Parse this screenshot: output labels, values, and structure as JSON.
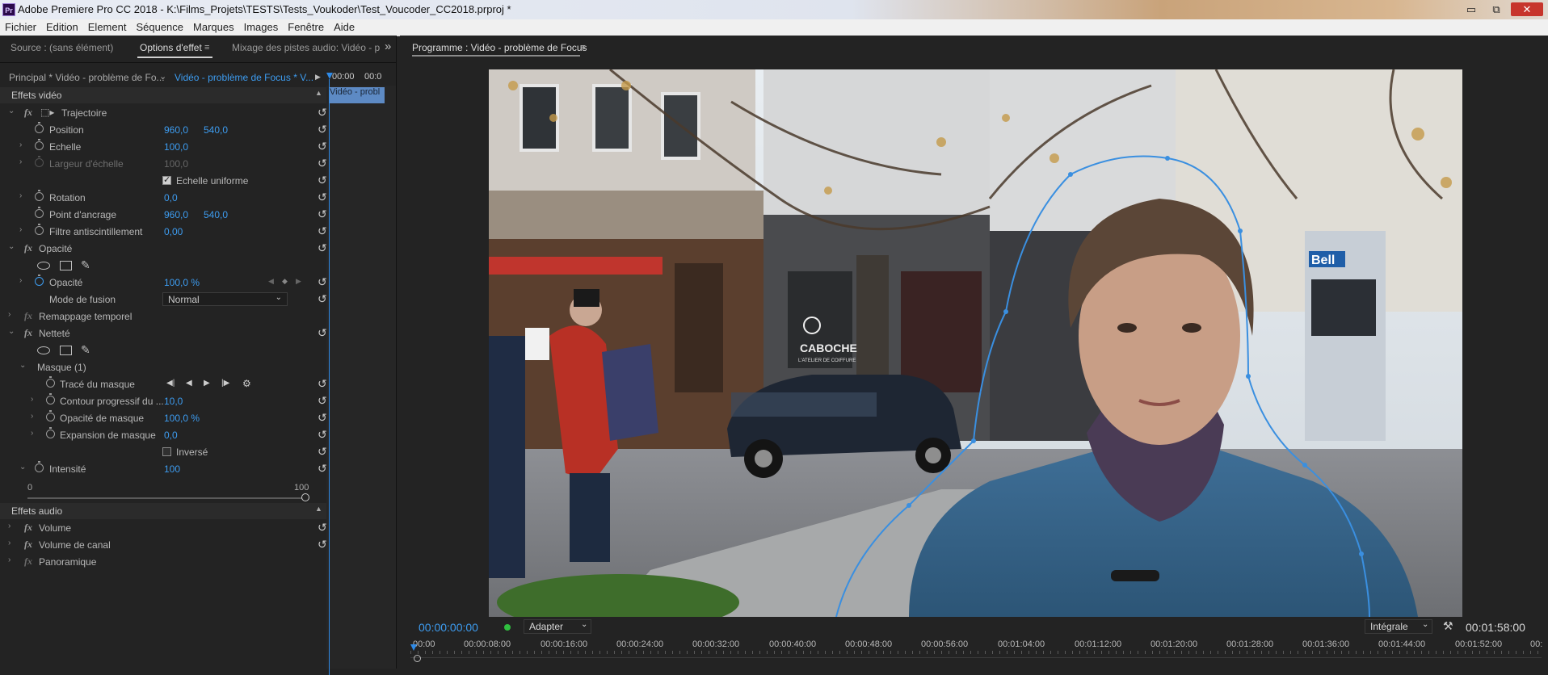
{
  "window": {
    "app_icon": "Pr",
    "title": "Adobe Premiere Pro CC 2018 - K:\\Films_Projets\\TESTS\\Tests_Voukoder\\Test_Voucoder_CC2018.prproj *",
    "minimize": "▭",
    "maximize": "⧉",
    "close": "✕"
  },
  "menu": [
    "Fichier",
    "Edition",
    "Element",
    "Séquence",
    "Marques",
    "Images",
    "Fenêtre",
    "Aide"
  ],
  "left_panel": {
    "tabs": {
      "source": "Source : (sans élément)",
      "effect_options": "Options d'effet",
      "audio_mix": "Mixage des pistes audio: Vidéo - p",
      "overflow": "»",
      "menu_icon": "≡"
    },
    "clip_selector": {
      "master": "Principal * Vidéo - problème de Fo...",
      "clip": "Vidéo - problème de Focus * V...",
      "play": "▶",
      "tc_start": "00:00",
      "tc_end": "00:0"
    },
    "mini_clip": "Vidéo - probl",
    "video_effects_header": "Effets vidéo",
    "audio_effects_header": "Effets audio",
    "effects": {
      "trajectoire": "Trajectoire",
      "position": {
        "label": "Position",
        "x": "960,0",
        "y": "540,0"
      },
      "echelle": {
        "label": "Echelle",
        "value": "100,0"
      },
      "largeur": {
        "label": "Largeur d'échelle",
        "value": "100,0"
      },
      "uniform": {
        "label": "Echelle uniforme"
      },
      "rotation": {
        "label": "Rotation",
        "value": "0,0"
      },
      "ancre": {
        "label": "Point d'ancrage",
        "x": "960,0",
        "y": "540,0"
      },
      "antiflicker": {
        "label": "Filtre antiscintillement",
        "value": "0,00"
      },
      "opacite_grp": "Opacité",
      "opacite": {
        "label": "Opacité",
        "value": "100,0 %"
      },
      "fusion": {
        "label": "Mode de fusion",
        "value": "Normal"
      },
      "remap": "Remappage temporel",
      "nettete": "Netteté",
      "masque": "Masque (1)",
      "trace": {
        "label": "Tracé du masque"
      },
      "contour": {
        "label": "Contour progressif du ...",
        "value": "10,0"
      },
      "mask_opacity": {
        "label": "Opacité de masque",
        "value": "100,0 %"
      },
      "mask_expansion": {
        "label": "Expansion de masque",
        "value": "0,0"
      },
      "inverse": {
        "label": "Inversé"
      },
      "intensite": {
        "label": "Intensité",
        "value": "100"
      },
      "slider_min": "0",
      "slider_max": "100",
      "volume": "Volume",
      "volume_canal": "Volume de canal",
      "panoramique": "Panoramique"
    }
  },
  "program": {
    "title": "Programme : Vidéo - problème de Focus",
    "menu_icon": "≡",
    "current_tc": "00:00:00:00",
    "fit": "Adapter",
    "quality": "Intégrale",
    "duration": "00:01:58:00",
    "ruler": [
      "00:00",
      "00:00:08:00",
      "00:00:16:00",
      "00:00:24:00",
      "00:00:32:00",
      "00:00:40:00",
      "00:00:48:00",
      "00:00:56:00",
      "00:01:04:00",
      "00:01:12:00",
      "00:01:20:00",
      "00:01:28:00",
      "00:01:36:00",
      "00:01:44:00",
      "00:01:52:00",
      "00:"
    ],
    "store_sign": "CABOCHE",
    "store_sub": "L'ATELIER DE COIFFURE",
    "bell_sign": "Bell"
  },
  "icons": {
    "reset": "↺",
    "chevron_right": "›",
    "chevron_down": "⌄",
    "wrench": "🔧"
  }
}
